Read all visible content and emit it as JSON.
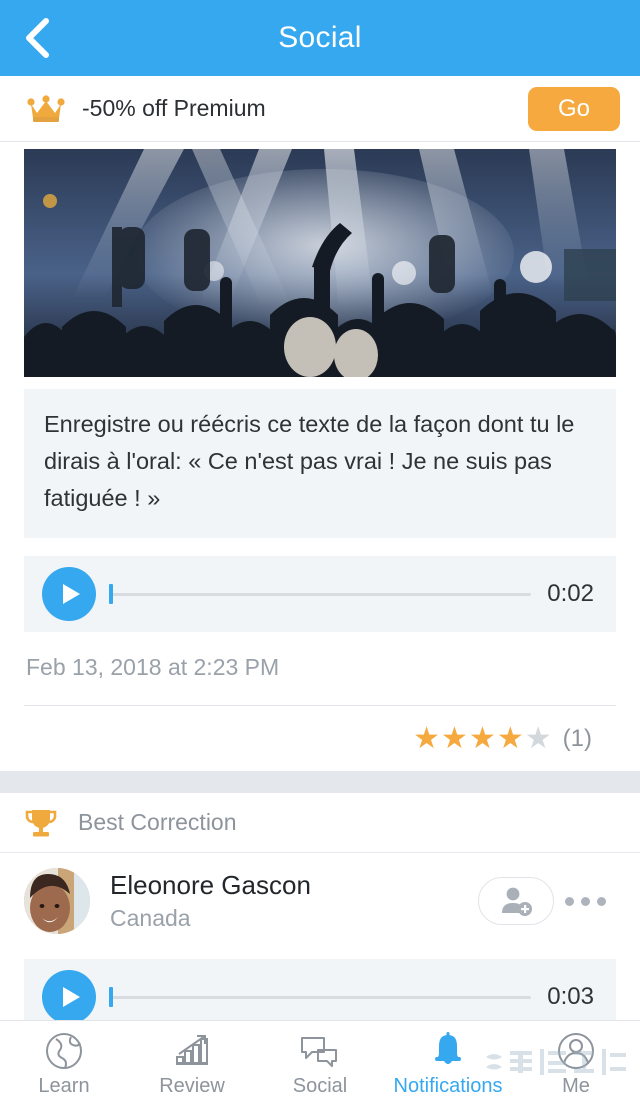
{
  "header": {
    "title": "Social",
    "back_icon": "chevron-left-icon",
    "background_color": "#35A8F0"
  },
  "promo": {
    "icon": "crown-icon",
    "text": "-50% off Premium",
    "button_label": "Go",
    "button_color": "#F5A93F"
  },
  "post": {
    "image_alt": "concert-crowd-photo",
    "prompt_text": "Enregistre ou réécris ce texte de la façon dont tu le dirais à l'oral: « Ce n'est pas vrai ! Je ne suis pas fatiguée ! »",
    "player": {
      "play_icon": "play-icon",
      "duration": "0:02",
      "progress_percent": 0
    },
    "timestamp": "Feb 13, 2018 at 2:23 PM",
    "rating": {
      "filled_stars": 4,
      "total_stars": 5,
      "count_label": "(1)",
      "star_color": "#F5A93F",
      "empty_star_color": "#D3D8DD"
    }
  },
  "best_correction": {
    "icon": "trophy-icon",
    "label": "Best Correction"
  },
  "correction": {
    "user": {
      "avatar": "user-avatar-photo",
      "name": "Eleonore Gascon",
      "country": "Canada"
    },
    "add_friend_icon": "add-person-icon",
    "more_icon": "more-horizontal-icon",
    "player": {
      "play_icon": "play-icon",
      "duration": "0:03",
      "progress_percent": 0
    }
  },
  "tabbar": {
    "active_color": "#35A8F0",
    "items": [
      {
        "label": "Learn",
        "icon": "globe-icon",
        "active": false
      },
      {
        "label": "Review",
        "icon": "bar-chart-arrow-icon",
        "active": false
      },
      {
        "label": "Social",
        "icon": "speech-bubbles-icon",
        "active": false
      },
      {
        "label": "Notifications",
        "icon": "bell-icon",
        "active": true
      },
      {
        "label": "Me",
        "icon": "person-circle-icon",
        "active": false
      }
    ]
  }
}
